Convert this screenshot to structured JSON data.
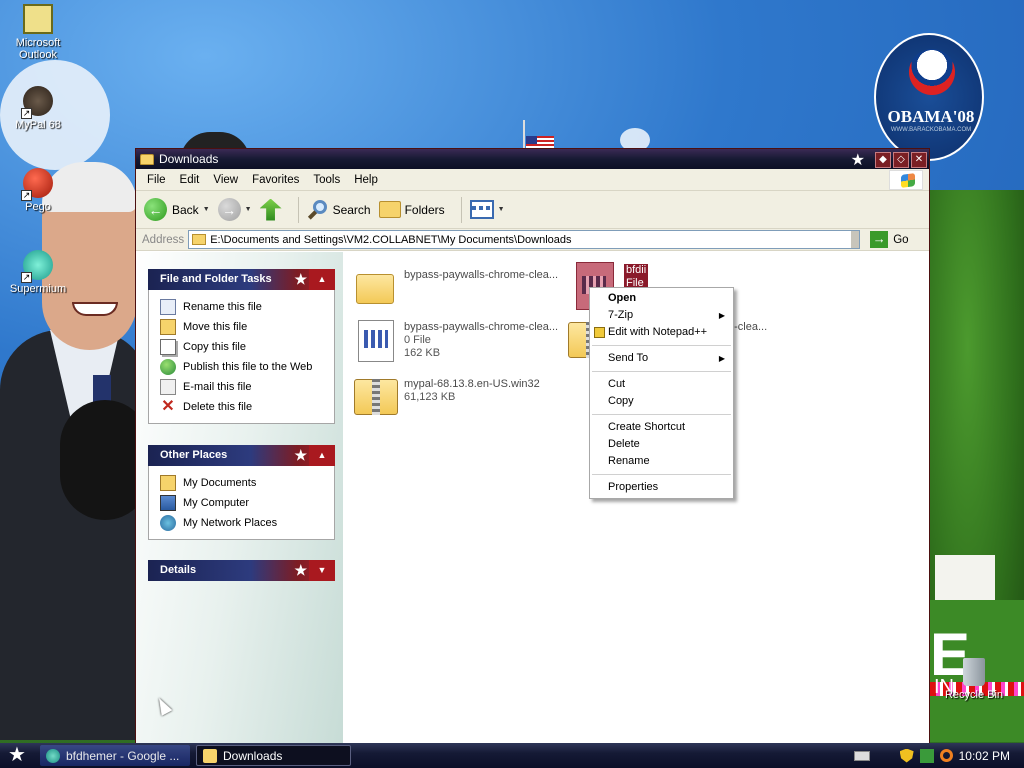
{
  "desktop": {
    "icons": [
      {
        "name": "outlook",
        "label_1": "Microsoft",
        "label_2": "Outlook",
        "icon": "outlook-icon"
      },
      {
        "name": "mypal",
        "label_1": "MyPal 68",
        "label_2": "",
        "icon": "mypal-icon"
      },
      {
        "name": "pego",
        "label_1": "Pego",
        "label_2": "",
        "icon": "pego-icon"
      },
      {
        "name": "supermium",
        "label_1": "Supermium",
        "label_2": "",
        "icon": "supermium-icon"
      },
      {
        "name": "recycle-bin",
        "label_1": "Recycle Bin",
        "label_2": "",
        "icon": "recycle-bin-icon"
      }
    ],
    "badge_text": "OBAMA'08",
    "badge_url": "WWW.BARACKOBAMA.COM",
    "big_letter": "E",
    "in_text": "IN"
  },
  "window": {
    "title": "Downloads",
    "menu": [
      "File",
      "Edit",
      "View",
      "Favorites",
      "Tools",
      "Help"
    ],
    "toolbar": {
      "back_label": "Back",
      "search_label": "Search",
      "folders_label": "Folders"
    },
    "address": {
      "label": "Address",
      "value": "E:\\Documents and Settings\\VM2.COLLABNET\\My Documents\\Downloads",
      "go_label": "Go"
    },
    "left_pane": {
      "file_tasks": {
        "title": "File and Folder Tasks",
        "items": [
          "Rename this file",
          "Move this file",
          "Copy this file",
          "Publish this file to the Web",
          "E-mail this file",
          "Delete this file"
        ]
      },
      "other_places": {
        "title": "Other Places",
        "items": [
          "My Documents",
          "My Computer",
          "My Network Places"
        ]
      },
      "details": {
        "title": "Details"
      }
    },
    "files": [
      {
        "name": "bypass-paywalls-chrome-clea...",
        "meta1": "",
        "meta2": "",
        "type": "folder"
      },
      {
        "name": "bypass-paywalls-chrome-clea...",
        "meta1": "0 File",
        "meta2": "162 KB",
        "type": "file"
      },
      {
        "name": "mypal-68.13.8.en-US.win32",
        "meta1": "61,123 KB",
        "meta2": "",
        "type": "zip"
      },
      {
        "name": "bfdii",
        "meta1": "File",
        "meta2": "",
        "type": "file-selected"
      },
      {
        "name": "e-clea...",
        "meta1": "",
        "meta2": "",
        "type": "zip"
      }
    ]
  },
  "context_menu": {
    "items": [
      {
        "label": "Open",
        "bold": true,
        "submenu": false
      },
      {
        "label": "7-Zip",
        "bold": false,
        "submenu": true
      },
      {
        "label": "Edit with Notepad++",
        "bold": false,
        "submenu": false
      },
      {
        "label": "Send To",
        "bold": false,
        "submenu": true
      },
      {
        "label": "Cut",
        "bold": false,
        "submenu": false
      },
      {
        "label": "Copy",
        "bold": false,
        "submenu": false
      },
      {
        "label": "Create Shortcut",
        "bold": false,
        "submenu": false
      },
      {
        "label": "Delete",
        "bold": false,
        "submenu": false
      },
      {
        "label": "Rename",
        "bold": false,
        "submenu": false
      },
      {
        "label": "Properties",
        "bold": false,
        "submenu": false
      }
    ]
  },
  "taskbar": {
    "tasks": [
      {
        "label": "bfdhemer - Google ...",
        "active": false
      },
      {
        "label": "Downloads",
        "active": true
      }
    ],
    "clock": "10:02 PM"
  }
}
